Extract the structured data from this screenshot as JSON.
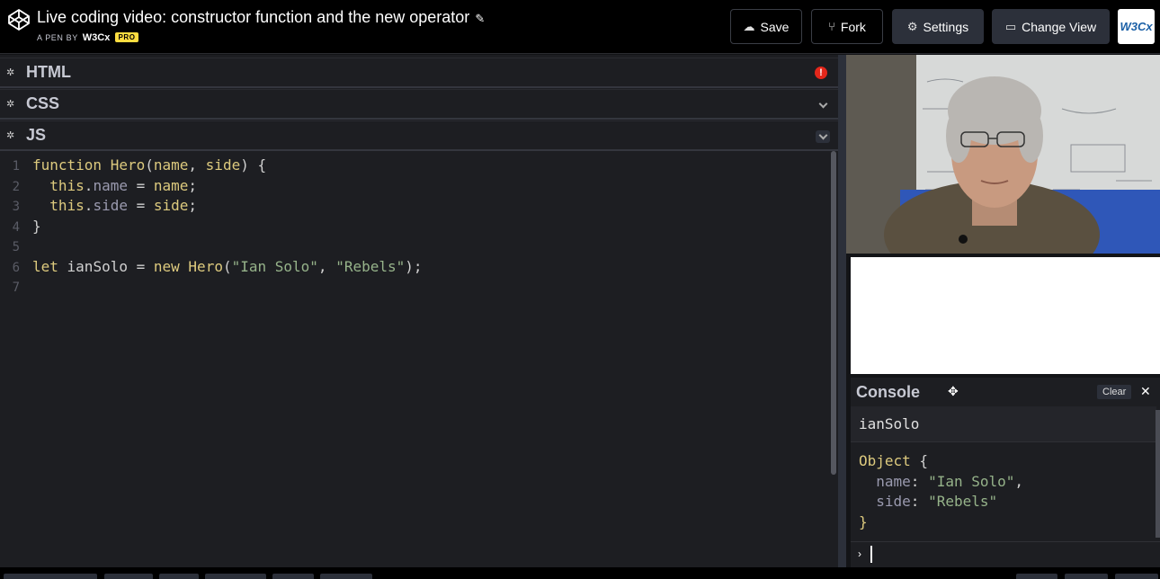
{
  "header": {
    "title": "Live coding video: constructor function and the new operator",
    "byline_prefix": "A PEN BY",
    "author": "W3Cx",
    "pro_badge": "PRO",
    "save_label": "Save",
    "fork_label": "Fork",
    "settings_label": "Settings",
    "change_view_label": "Change View",
    "avatar_text": "W3Cx"
  },
  "panels": {
    "html_label": "HTML",
    "css_label": "CSS",
    "js_label": "JS"
  },
  "js_code": {
    "line_numbers": [
      "1",
      "2",
      "3",
      "4",
      "5",
      "6",
      "7"
    ]
  },
  "console": {
    "title": "Console",
    "clear_label": "Clear",
    "log_entry": "ianSolo",
    "object_keyword": "Object",
    "object_props": [
      {
        "key": "name",
        "value": "\"Ian Solo\""
      },
      {
        "key": "side",
        "value": "\"Rebels\""
      }
    ]
  },
  "colors": {
    "accent": "#ffdd40",
    "error": "#e3271b",
    "keyword": "#ddca7e",
    "string": "#96b38a"
  }
}
